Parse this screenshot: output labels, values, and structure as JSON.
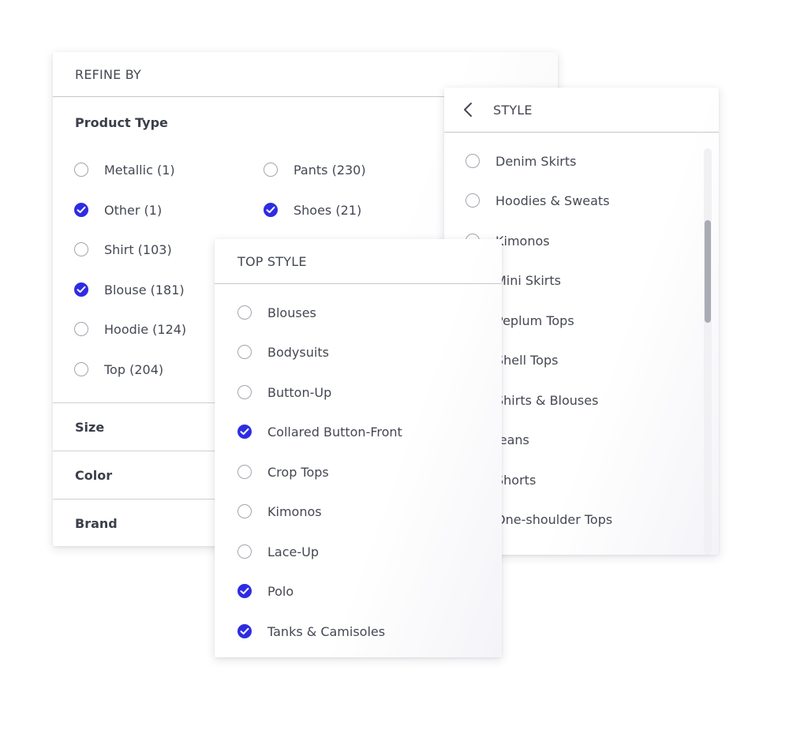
{
  "refine": {
    "header": "REFINE BY",
    "product_type": {
      "title": "Product Type",
      "options": [
        {
          "label": "Metallic (1)",
          "checked": false
        },
        {
          "label": "Pants (230)",
          "checked": false
        },
        {
          "label": "Other (1)",
          "checked": true
        },
        {
          "label": "Shoes (21)",
          "checked": true
        },
        {
          "label": "Shirt (103)",
          "checked": false
        },
        {
          "label": "Blouse (181)",
          "checked": true
        },
        {
          "label": "Hoodie (124)",
          "checked": false
        },
        {
          "label": "Top (204)",
          "checked": false
        }
      ]
    },
    "sections": [
      {
        "label": "Size"
      },
      {
        "label": "Color"
      },
      {
        "label": "Brand"
      }
    ]
  },
  "top_style": {
    "header": "TOP STYLE",
    "options": [
      {
        "label": "Blouses",
        "checked": false
      },
      {
        "label": "Bodysuits",
        "checked": false
      },
      {
        "label": "Button-Up",
        "checked": false
      },
      {
        "label": "Collared Button-Front",
        "checked": true
      },
      {
        "label": "Crop Tops",
        "checked": false
      },
      {
        "label": "Kimonos",
        "checked": false
      },
      {
        "label": "Lace-Up",
        "checked": false
      },
      {
        "label": "Polo",
        "checked": true
      },
      {
        "label": "Tanks & Camisoles",
        "checked": true
      }
    ]
  },
  "style": {
    "header": "STYLE",
    "back_icon": "chevron-left-icon",
    "options": [
      {
        "label": "Denim Skirts",
        "checked": false
      },
      {
        "label": "Hoodies & Sweats",
        "checked": false
      },
      {
        "label": "Kimonos",
        "checked": false
      },
      {
        "label": "Mini Skirts",
        "checked": true
      },
      {
        "label": "Peplum Tops",
        "checked": false
      },
      {
        "label": "Shell Tops",
        "checked": false
      },
      {
        "label": "Shirts & Blouses",
        "checked": false
      },
      {
        "label": "Jeans",
        "checked": false
      },
      {
        "label": "Shorts",
        "checked": false
      },
      {
        "label": "One-shoulder Tops",
        "checked": false
      }
    ]
  },
  "colors": {
    "accent": "#2e2ce3",
    "radio_border": "#a3a5ae"
  }
}
